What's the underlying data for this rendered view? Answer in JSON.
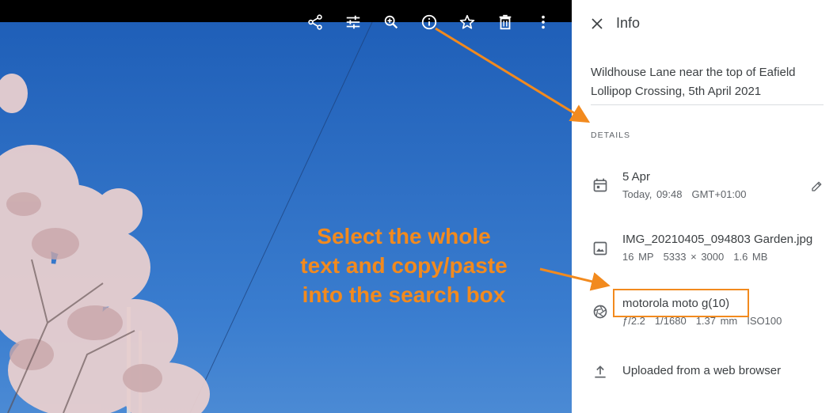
{
  "toolbar": {
    "icons": [
      "share-icon",
      "tune-icon",
      "zoom-in-icon",
      "info-icon",
      "star-icon",
      "delete-icon",
      "more-vert-icon"
    ]
  },
  "panel": {
    "title": "Info",
    "description": "Wildhouse Lane near the top of Eafield Lollipop Crossing, 5th April 2021",
    "details_heading": "DETAILS",
    "date": {
      "title": "5 Apr",
      "time": "Today, 09:48",
      "timezone": "GMT+01:00"
    },
    "file": {
      "name": "IMG_20210405_094803 Garden.jpg",
      "megapixels": "16 MP",
      "resolution": "5333 × 3000",
      "size": "1.6 MB"
    },
    "camera": {
      "model": "motorola moto g(10)",
      "aperture": "ƒ/2.2",
      "shutter": "1/1680",
      "focal": "1.37 mm",
      "iso": "ISO100"
    },
    "upload": {
      "text": "Uploaded from a web browser"
    }
  },
  "annotation": {
    "line1": "Select the whole",
    "line2": "text and copy/paste",
    "line3": "into the search box"
  },
  "colors": {
    "accent": "#f28a1e",
    "sky": "#2e6fc4",
    "text": "#3c4043",
    "subtext": "#5f6368"
  }
}
